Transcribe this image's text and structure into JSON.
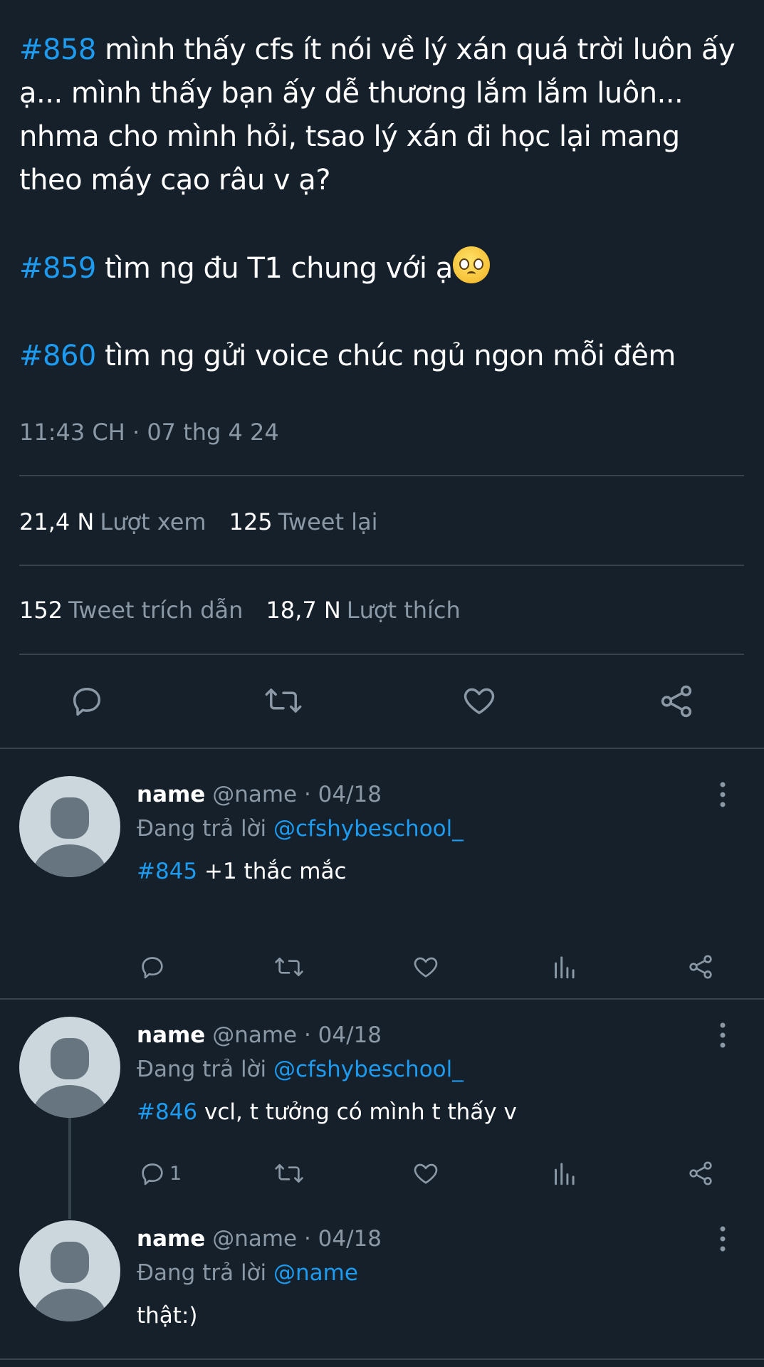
{
  "main_tweet": {
    "paragraphs": [
      {
        "tag": "#858",
        "text": " mình thấy cfs ít nói về lý xán quá trời luôn ấy ạ... mình thấy bạn ấy dễ thương lắm lắm luôn... nhma cho mình hỏi, tsao lý xán đi học lại mang theo máy cạo râu v ạ?"
      },
      {
        "tag": "#859",
        "text": " tìm ng đu T1 chung với ạ"
      },
      {
        "tag": "#860",
        "text": " tìm ng gửi voice chúc ngủ ngon mỗi đêm"
      }
    ],
    "emoji_icon": "pleading-face-emoji",
    "timestamp": "11:43 CH · 07 thg 4 24",
    "stats": {
      "views_num": "21,4 N",
      "views_label": "Lượt xem",
      "retweets_num": "125",
      "retweets_label": "Tweet lại",
      "quotes_num": "152",
      "quotes_label": "Tweet trích dẫn",
      "likes_num": "18,7 N",
      "likes_label": "Lượt thích"
    },
    "actions": [
      "reply-icon",
      "retweet-icon",
      "like-icon",
      "share-icon"
    ]
  },
  "replies": [
    {
      "name": "name",
      "handle": "@name · 04/18",
      "replying_label": "Đang trả lời",
      "replying_to": "@cfshybeschool_",
      "tag": "#845",
      "text": " +1 thắc mắc",
      "reply_count": ""
    },
    {
      "name": "name",
      "handle": "@name · 04/18",
      "replying_label": "Đang trả lời",
      "replying_to": "@cfshybeschool_",
      "tag": "#846",
      "text": " vcl, t tưởng có mình t thấy v",
      "reply_count": "1"
    },
    {
      "name": "name",
      "handle": "@name · 04/18",
      "replying_label": "Đang trả lời",
      "replying_to": "@name",
      "tag": "",
      "text": "thật:)",
      "reply_count": ""
    }
  ],
  "colors": {
    "background": "#15202b",
    "link": "#1d9bf0",
    "secondary_text": "#8b98a5",
    "divider": "#38444d"
  }
}
